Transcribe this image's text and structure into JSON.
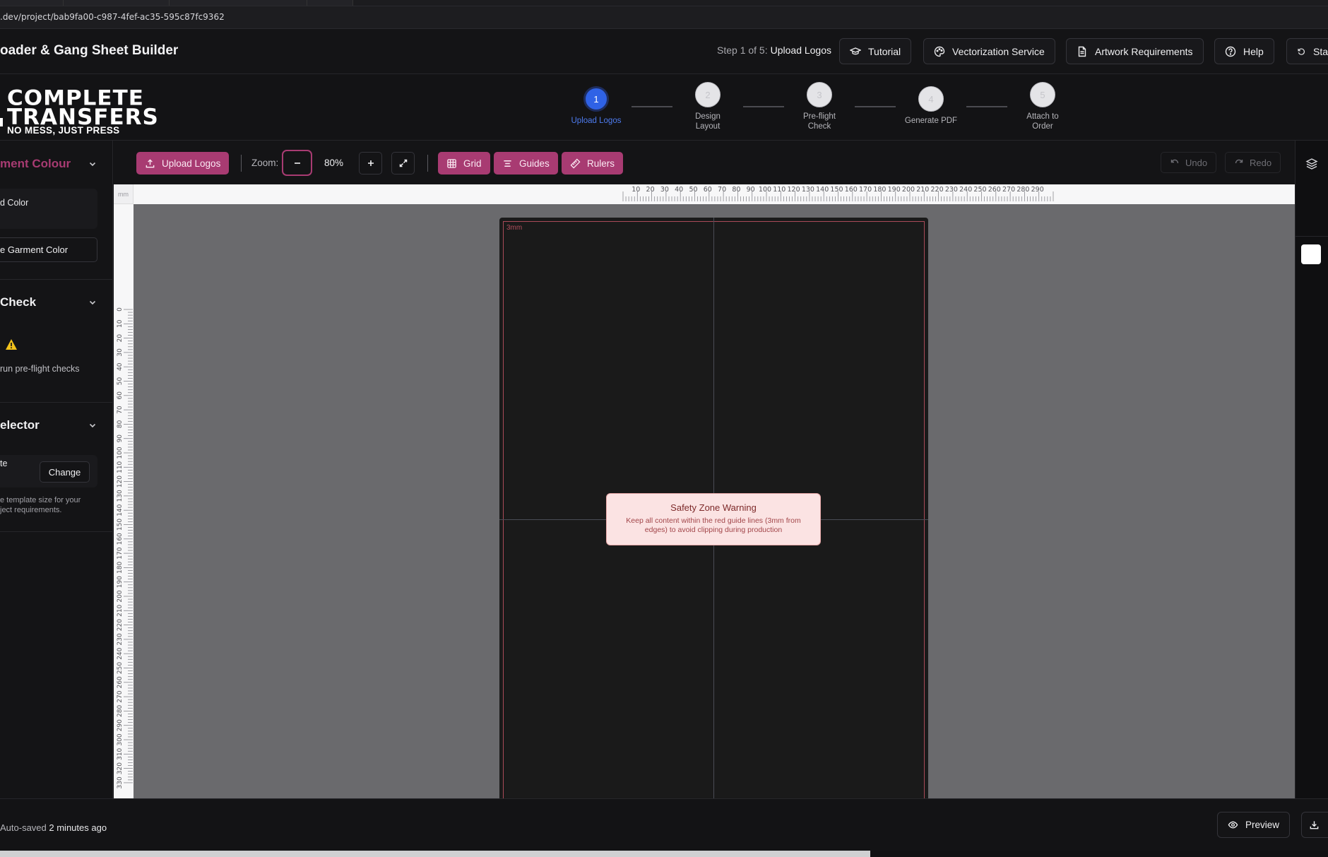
{
  "browser": {
    "url": ".dev/project/bab9fa00-c987-4fef-ac35-595c87fc9362"
  },
  "header": {
    "title": "oader & Gang Sheet Builder",
    "step_prefix": "Step 1 of 5:",
    "step_current": "Upload Logos",
    "buttons": {
      "tutorial": "Tutorial",
      "vectorization": "Vectorization Service",
      "artwork": "Artwork Requirements",
      "help": "Help",
      "start": "Sta"
    }
  },
  "brand": {
    "line1": "COMPLETE",
    "line2": "TRANSFERS",
    "tagline": "NO MESS, JUST PRESS"
  },
  "stepper": [
    {
      "num": "1",
      "label": "Upload Logos",
      "active": true
    },
    {
      "num": "2",
      "label": "Design Layout",
      "active": false
    },
    {
      "num": "3",
      "label": "Pre-flight Check",
      "active": false
    },
    {
      "num": "4",
      "label": "Generate PDF",
      "active": false
    },
    {
      "num": "5",
      "label": "Attach to Order",
      "active": false
    }
  ],
  "sidebar": {
    "garment": {
      "title": "ment Colour",
      "card_text": "d Color",
      "button": "e Garment Color"
    },
    "preflight": {
      "title": "Check",
      "text": "run pre-flight checks"
    },
    "selector": {
      "title": "elector",
      "value": "te",
      "button": "Change",
      "help1": "e template size for your",
      "help2": "ject requirements."
    }
  },
  "toolbar": {
    "upload": "Upload Logos",
    "zoom_label": "Zoom:",
    "zoom_value": "80%",
    "grid": "Grid",
    "guides": "Guides",
    "rulers": "Rulers",
    "undo": "Undo",
    "redo": "Redo"
  },
  "ruler": {
    "unit": "mm",
    "top_labels": [
      "10",
      "20",
      "30",
      "40",
      "50",
      "60",
      "70",
      "80",
      "90",
      "100",
      "110",
      "120",
      "130",
      "140",
      "150",
      "160",
      "170",
      "180",
      "190",
      "200",
      "210",
      "220",
      "230",
      "240",
      "250",
      "260",
      "270",
      "280",
      "290"
    ],
    "left_labels": [
      "0",
      "10",
      "20",
      "30",
      "40",
      "50",
      "60",
      "70",
      "80",
      "90",
      "100",
      "110",
      "120",
      "130",
      "140",
      "150",
      "160",
      "170",
      "180",
      "190",
      "200",
      "210",
      "220",
      "230",
      "240",
      "250",
      "260",
      "270",
      "280",
      "290",
      "300",
      "310",
      "320",
      "330"
    ]
  },
  "canvas": {
    "safe_label": "3mm",
    "warning_title": "Safety Zone Warning",
    "warning_text": "Keep all content within the red guide lines (3mm from edges) to avoid clipping during production"
  },
  "footer": {
    "saved_prefix": "Auto-saved",
    "saved_time": "2 minutes ago",
    "preview": "Preview"
  },
  "colors": {
    "accent_pink": "#a83b72",
    "step_active": "#2f62e6",
    "safety_line": "#a94a58",
    "canvas_bg": "#6a6a6d",
    "artboard": "#1a1a1a"
  }
}
